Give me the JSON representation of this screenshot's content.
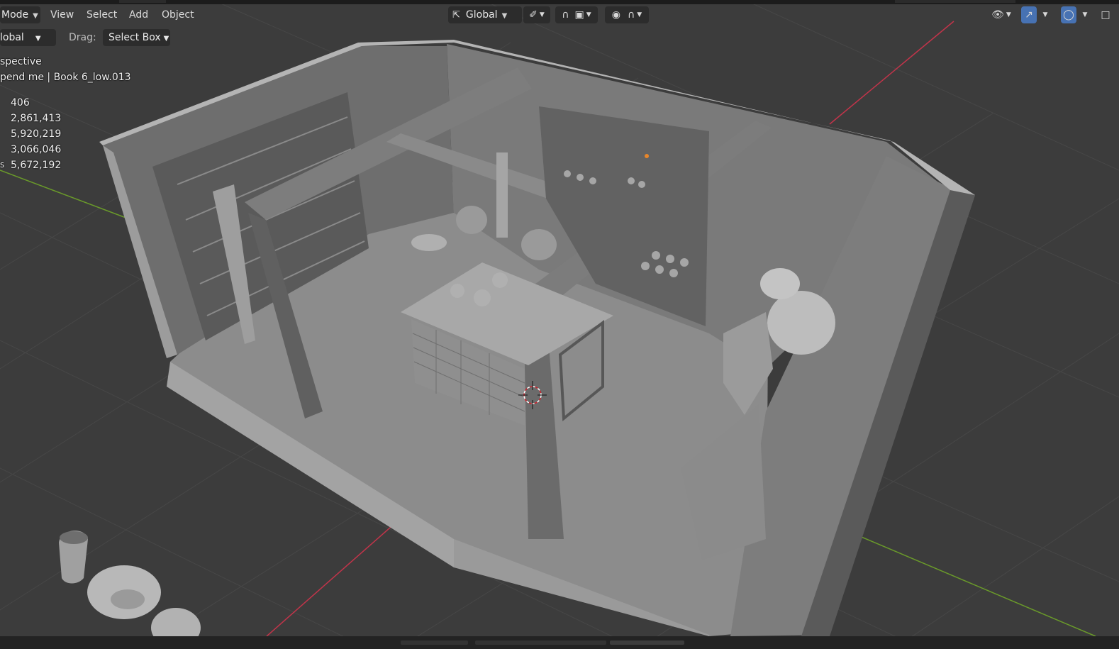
{
  "header": {
    "mode_label": "Mode",
    "menus": [
      "View",
      "Select",
      "Add",
      "Object"
    ],
    "transform_orientation": "Global"
  },
  "tool_settings": {
    "orientation_label": "lobal",
    "drag_label": "Drag:",
    "drag_value": "Select Box"
  },
  "viewport_info": {
    "view_name": "spective",
    "collection_object": "pend me | Book 6_low.013"
  },
  "statistics": {
    "objects": "406",
    "vertices": "2,861,413",
    "edges": "5,920,219",
    "faces": "3,066,046",
    "triangles_prefix": "s",
    "triangles": "5,672,192"
  },
  "icons": {
    "transform_pivot": "transform-orientation-icon",
    "snap": "snap-magnet-icon",
    "proportional": "proportional-editing-icon",
    "visibility": "eye-icon",
    "gizmo": "gizmo-icon",
    "overlay": "overlay-icon"
  },
  "colors": {
    "accent": "#4772b3",
    "axis_x": "#c2344a",
    "axis_y": "#6a9a2a",
    "grid": "#484848"
  }
}
